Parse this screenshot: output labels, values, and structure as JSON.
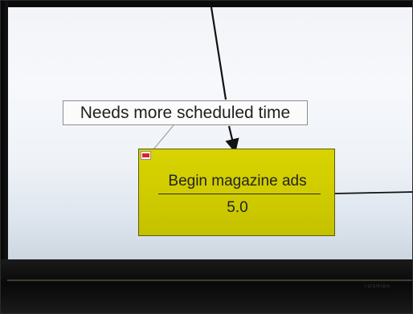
{
  "annotation": {
    "text": "Needs more scheduled time"
  },
  "task": {
    "title": "Begin magazine ads",
    "duration": "5.0",
    "fill_color": "#cfcb00",
    "toggle_color": "#e0212b"
  },
  "bezel": {
    "brand": "TOSHIBA"
  },
  "icons": {
    "collapse": "minus-icon"
  }
}
